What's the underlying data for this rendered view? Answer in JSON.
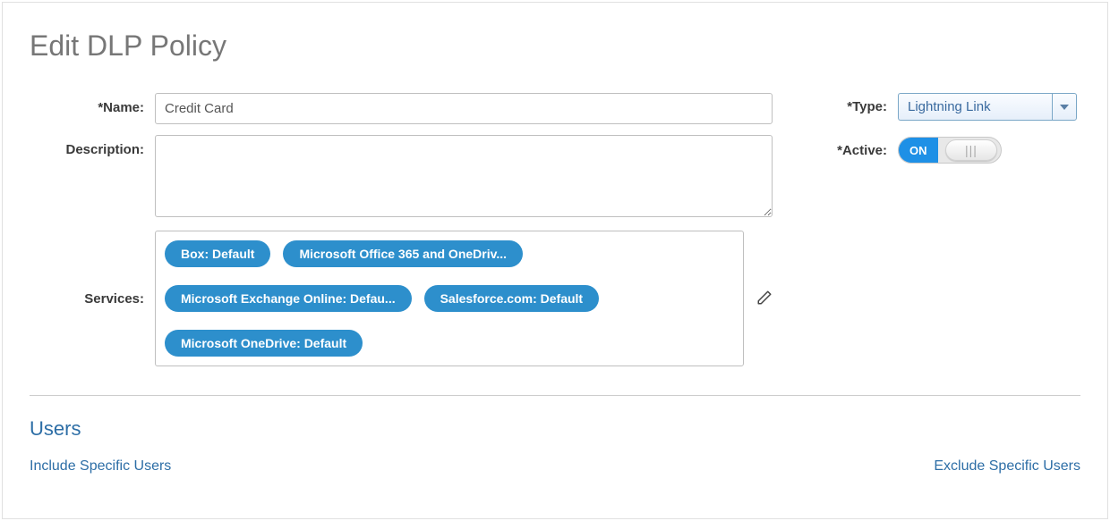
{
  "page_title": "Edit DLP Policy",
  "form": {
    "name_label": "*Name:",
    "name_value": "Credit Card",
    "description_label": "Description:",
    "description_value": "",
    "services_label": "Services:",
    "services": [
      "Box: Default",
      "Microsoft Office 365 and OneDriv...",
      "Microsoft Exchange Online: Defau...",
      "Salesforce.com: Default",
      "Microsoft OneDrive: Default"
    ]
  },
  "right": {
    "type_label": "*Type:",
    "type_value": "Lightning Link",
    "active_label": "*Active:",
    "active_on_text": "ON"
  },
  "users": {
    "section_title": "Users",
    "include_title": "Include Specific Users",
    "exclude_title": "Exclude Specific Users"
  }
}
